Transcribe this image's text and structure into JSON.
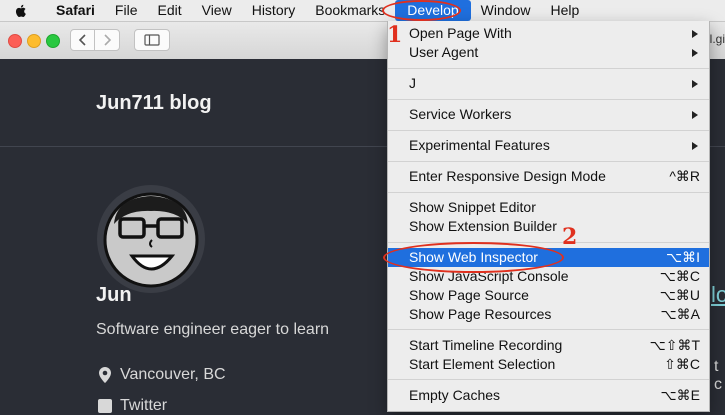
{
  "menubar": {
    "app_name": "Safari",
    "items": [
      "File",
      "Edit",
      "View",
      "History",
      "Bookmarks",
      "Develop",
      "Window",
      "Help"
    ]
  },
  "toolbar": {
    "url_fragment": "l.gi"
  },
  "blog": {
    "title": "Jun711 blog",
    "author_name": "Jun",
    "bio": "Software engineer eager to learn",
    "location": "Vancouver, BC",
    "twitter": "Twitter",
    "bg_link_fragment": "lo",
    "bg_text_fragment": "t c"
  },
  "develop_menu": {
    "items": [
      {
        "label": "Open Page With",
        "submenu": true
      },
      {
        "label": "User Agent",
        "submenu": true
      },
      {
        "label": "J",
        "submenu": true
      },
      {
        "label": "Service Workers",
        "submenu": true
      },
      {
        "label": "Experimental Features",
        "submenu": true
      },
      {
        "label": "Enter Responsive Design Mode",
        "shortcut": "^⌘R"
      },
      {
        "label": "Show Snippet Editor"
      },
      {
        "label": "Show Extension Builder"
      },
      {
        "label": "Show Web Inspector",
        "shortcut": "⌥⌘I",
        "highlighted": true
      },
      {
        "label": "Show JavaScript Console",
        "shortcut": "⌥⌘C"
      },
      {
        "label": "Show Page Source",
        "shortcut": "⌥⌘U"
      },
      {
        "label": "Show Page Resources",
        "shortcut": "⌥⌘A"
      },
      {
        "label": "Start Timeline Recording",
        "shortcut": "⌥⇧⌘T"
      },
      {
        "label": "Start Element Selection",
        "shortcut": "⇧⌘C"
      },
      {
        "label": "Empty Caches",
        "shortcut": "⌥⌘E"
      }
    ]
  },
  "annotations": {
    "step1": "1",
    "step2": "2"
  },
  "colors": {
    "highlight": "#1f6fde",
    "annotation": "#e0301e",
    "page_bg": "#2a2d35"
  }
}
